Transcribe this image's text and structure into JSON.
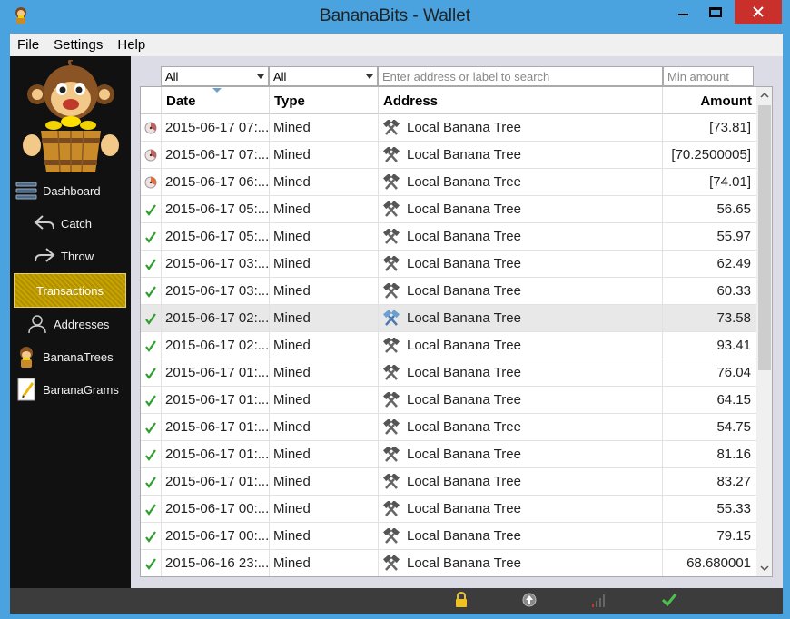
{
  "window": {
    "title": "BananaBits - Wallet"
  },
  "menu": [
    "File",
    "Settings",
    "Help"
  ],
  "sidebar": {
    "items": [
      {
        "label": "Dashboard",
        "icon": "dashboard-icon"
      },
      {
        "label": "Catch",
        "icon": "catch-arrow-icon"
      },
      {
        "label": "Throw",
        "icon": "throw-arrow-icon"
      },
      {
        "label": "Transactions",
        "icon": "none",
        "active": true
      },
      {
        "label": "Addresses",
        "icon": "person-icon"
      },
      {
        "label": "BananaTrees",
        "icon": "monkey-icon"
      },
      {
        "label": "BananaGrams",
        "icon": "notepad-icon"
      }
    ]
  },
  "filters": {
    "date": "All",
    "type": "All",
    "search_placeholder": "Enter address or label to search",
    "amount_placeholder": "Min amount"
  },
  "table": {
    "headers": {
      "date": "Date",
      "type": "Type",
      "address": "Address",
      "amount": "Amount"
    },
    "rows": [
      {
        "status": "pending",
        "date": "2015-06-17 07:...",
        "type": "Mined",
        "address": "Local Banana Tree",
        "amount": "[73.81]"
      },
      {
        "status": "pending",
        "date": "2015-06-17 07:...",
        "type": "Mined",
        "address": "Local Banana Tree",
        "amount": "[70.2500005]"
      },
      {
        "status": "pending-orange",
        "date": "2015-06-17 06:...",
        "type": "Mined",
        "address": "Local Banana Tree",
        "amount": "[74.01]"
      },
      {
        "status": "confirmed",
        "date": "2015-06-17 05:...",
        "type": "Mined",
        "address": "Local Banana Tree",
        "amount": "56.65"
      },
      {
        "status": "confirmed",
        "date": "2015-06-17 05:...",
        "type": "Mined",
        "address": "Local Banana Tree",
        "amount": "55.97"
      },
      {
        "status": "confirmed",
        "date": "2015-06-17 03:...",
        "type": "Mined",
        "address": "Local Banana Tree",
        "amount": "62.49"
      },
      {
        "status": "confirmed",
        "date": "2015-06-17 03:...",
        "type": "Mined",
        "address": "Local Banana Tree",
        "amount": "60.33"
      },
      {
        "status": "confirmed",
        "date": "2015-06-17 02:...",
        "type": "Mined",
        "address": "Local Banana Tree",
        "amount": "73.58",
        "selected": true
      },
      {
        "status": "confirmed",
        "date": "2015-06-17 02:...",
        "type": "Mined",
        "address": "Local Banana Tree",
        "amount": "93.41"
      },
      {
        "status": "confirmed",
        "date": "2015-06-17 01:...",
        "type": "Mined",
        "address": "Local Banana Tree",
        "amount": "76.04"
      },
      {
        "status": "confirmed",
        "date": "2015-06-17 01:...",
        "type": "Mined",
        "address": "Local Banana Tree",
        "amount": "64.15"
      },
      {
        "status": "confirmed",
        "date": "2015-06-17 01:...",
        "type": "Mined",
        "address": "Local Banana Tree",
        "amount": "54.75"
      },
      {
        "status": "confirmed",
        "date": "2015-06-17 01:...",
        "type": "Mined",
        "address": "Local Banana Tree",
        "amount": "81.16"
      },
      {
        "status": "confirmed",
        "date": "2015-06-17 01:...",
        "type": "Mined",
        "address": "Local Banana Tree",
        "amount": "83.27"
      },
      {
        "status": "confirmed",
        "date": "2015-06-17 00:...",
        "type": "Mined",
        "address": "Local Banana Tree",
        "amount": "55.33"
      },
      {
        "status": "confirmed",
        "date": "2015-06-17 00:...",
        "type": "Mined",
        "address": "Local Banana Tree",
        "amount": "79.15"
      },
      {
        "status": "confirmed",
        "date": "2015-06-16 23:...",
        "type": "Mined",
        "address": "Local Banana Tree",
        "amount": "68.680001"
      }
    ]
  },
  "statusbar": {
    "icons": [
      "lock-icon",
      "sync-icon",
      "signal-bars-icon",
      "checkmark-icon"
    ]
  },
  "colors": {
    "titlebar": "#4aa3df",
    "sidebar": "#111111",
    "active_nav": "#c8a400",
    "check_green": "#2e9e2e",
    "close_red": "#c9302c"
  }
}
